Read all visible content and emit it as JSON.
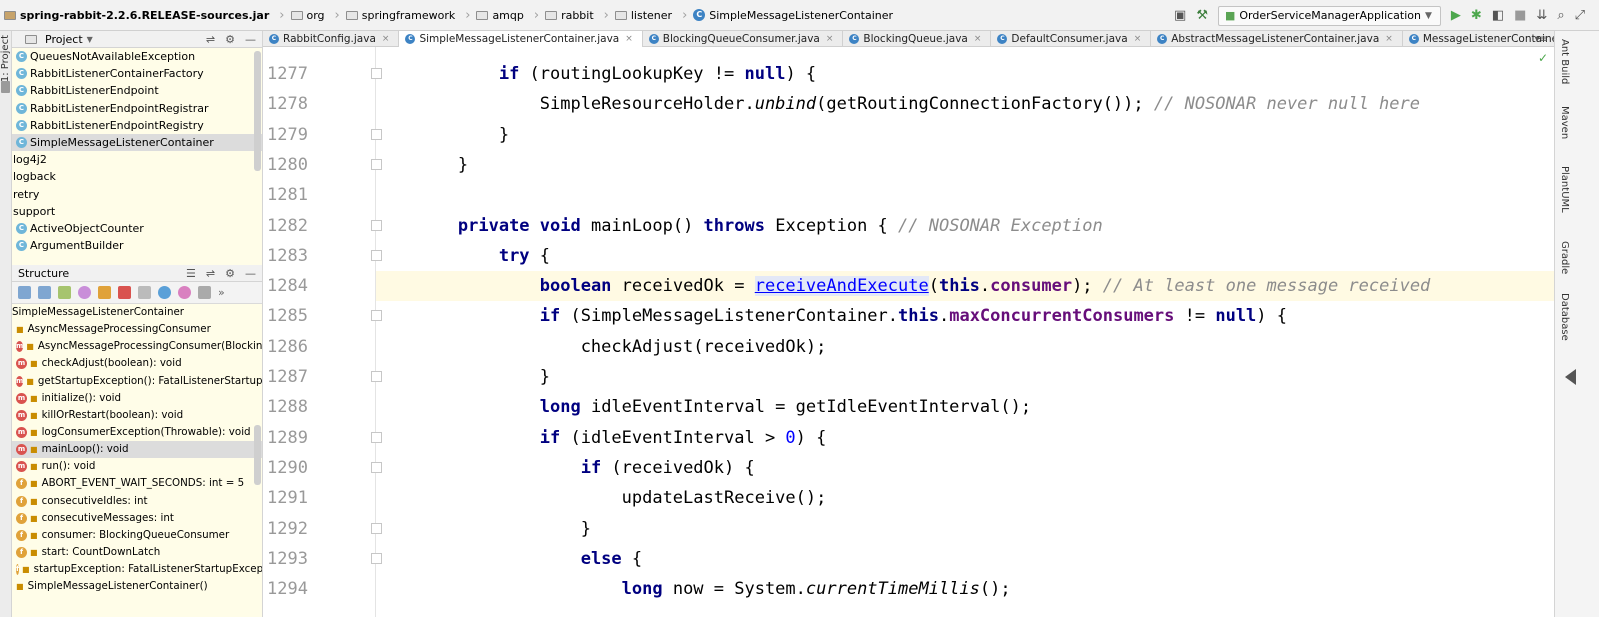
{
  "breadcrumbs": [
    {
      "label": "spring-rabbit-2.2.6.RELEASE-sources.jar",
      "kind": "jar"
    },
    {
      "label": "org",
      "kind": "folder"
    },
    {
      "label": "springframework",
      "kind": "folder"
    },
    {
      "label": "amqp",
      "kind": "folder"
    },
    {
      "label": "rabbit",
      "kind": "folder"
    },
    {
      "label": "listener",
      "kind": "folder"
    },
    {
      "label": "SimpleMessageListenerContainer",
      "kind": "class"
    }
  ],
  "run_config": {
    "label": "OrderServiceManagerApplication"
  },
  "left_strip": {
    "project_label": "1: Project"
  },
  "right_strip": [
    "Ant Build",
    "Maven",
    "PlantUML",
    "Gradle",
    "Database"
  ],
  "project_panel": {
    "title": "Project",
    "items": [
      {
        "label": "QueuesNotAvailableException",
        "kind": "class"
      },
      {
        "label": "RabbitListenerContainerFactory",
        "kind": "class"
      },
      {
        "label": "RabbitListenerEndpoint",
        "kind": "class"
      },
      {
        "label": "RabbitListenerEndpointRegistrar",
        "kind": "class"
      },
      {
        "label": "RabbitListenerEndpointRegistry",
        "kind": "class"
      },
      {
        "label": "SimpleMessageListenerContainer",
        "kind": "class",
        "selected": true
      },
      {
        "label": "log4j2",
        "kind": "package"
      },
      {
        "label": "logback",
        "kind": "package"
      },
      {
        "label": "retry",
        "kind": "package"
      },
      {
        "label": "support",
        "kind": "package"
      },
      {
        "label": "ActiveObjectCounter",
        "kind": "class"
      },
      {
        "label": "ArgumentBuilder",
        "kind": "class"
      }
    ]
  },
  "structure_panel": {
    "title": "Structure",
    "items": [
      {
        "label": "SimpleMessageListenerContainer",
        "icon": "none",
        "indent": 0
      },
      {
        "label": "AsyncMessageProcessingConsumer",
        "icon": "lock",
        "indent": 1
      },
      {
        "label": "AsyncMessageProcessingConsumer(BlockingQ",
        "icon": "m",
        "indent": 2
      },
      {
        "label": "checkAdjust(boolean): void",
        "icon": "m",
        "indent": 2
      },
      {
        "label": "getStartupException(): FatalListenerStartupExce",
        "icon": "m",
        "indent": 2
      },
      {
        "label": "initialize(): void",
        "icon": "m",
        "indent": 2
      },
      {
        "label": "killOrRestart(boolean): void",
        "icon": "m",
        "indent": 2
      },
      {
        "label": "logConsumerException(Throwable): void",
        "icon": "m",
        "indent": 2
      },
      {
        "label": "mainLoop(): void",
        "icon": "m",
        "indent": 2,
        "selected": true
      },
      {
        "label": "run(): void",
        "icon": "m",
        "indent": 2
      },
      {
        "label": "ABORT_EVENT_WAIT_SECONDS: int = 5",
        "icon": "f",
        "indent": 2
      },
      {
        "label": "consecutiveIdles: int",
        "icon": "f",
        "indent": 2
      },
      {
        "label": "consecutiveMessages: int",
        "icon": "f",
        "indent": 2
      },
      {
        "label": "consumer: BlockingQueueConsumer",
        "icon": "f",
        "indent": 2
      },
      {
        "label": "start: CountDownLatch",
        "icon": "f",
        "indent": 2
      },
      {
        "label": "startupException: FatalListenerStartupExceptio",
        "icon": "f",
        "indent": 2
      },
      {
        "label": "SimpleMessageListenerContainer()",
        "icon": "lock",
        "indent": 1
      }
    ]
  },
  "tabs": [
    {
      "label": "RabbitConfig.java",
      "active": false
    },
    {
      "label": "SimpleMessageListenerContainer.java",
      "active": true
    },
    {
      "label": "BlockingQueueConsumer.java",
      "active": false
    },
    {
      "label": "BlockingQueue.java",
      "active": false
    },
    {
      "label": "DefaultConsumer.java",
      "active": false
    },
    {
      "label": "AbstractMessageListenerContainer.java",
      "active": false
    },
    {
      "label": "MessageListenerContainer.java",
      "active": false
    }
  ],
  "editor": {
    "current_line": 1284,
    "lines": [
      {
        "n": "1277",
        "fold": true,
        "segs": [
          [
            "            ",
            ""
          ],
          [
            "if",
            "kw"
          ],
          [
            " (routingLookupKey != ",
            ""
          ],
          [
            "null",
            "kw"
          ],
          [
            ") {",
            ""
          ]
        ]
      },
      {
        "n": "1278",
        "fold": false,
        "segs": [
          [
            "                SimpleResourceHolder.",
            ""
          ],
          [
            "unbind",
            "it"
          ],
          [
            "(getRoutingConnectionFactory()); ",
            ""
          ],
          [
            "// NOSONAR never null here",
            "cm"
          ]
        ]
      },
      {
        "n": "1279",
        "fold": true,
        "segs": [
          [
            "            }",
            ""
          ]
        ]
      },
      {
        "n": "1280",
        "fold": true,
        "segs": [
          [
            "        }",
            ""
          ]
        ]
      },
      {
        "n": "1281",
        "fold": false,
        "segs": [
          [
            "",
            ""
          ]
        ]
      },
      {
        "n": "1282",
        "fold": true,
        "segs": [
          [
            "        ",
            ""
          ],
          [
            "private void",
            "kw"
          ],
          [
            " mainLoop() ",
            ""
          ],
          [
            "throws",
            "kw"
          ],
          [
            " Exception { ",
            ""
          ],
          [
            "// NOSONAR Exception",
            "cm"
          ]
        ]
      },
      {
        "n": "1283",
        "fold": true,
        "segs": [
          [
            "            ",
            ""
          ],
          [
            "try",
            "kw"
          ],
          [
            " {",
            ""
          ]
        ]
      },
      {
        "n": "1284",
        "fold": false,
        "segs": [
          [
            "                ",
            ""
          ],
          [
            "boolean",
            "kw"
          ],
          [
            " receivedOk = ",
            ""
          ],
          [
            "receiveAndExecute",
            "link"
          ],
          [
            "(",
            ""
          ],
          [
            "this",
            "kw"
          ],
          [
            ".",
            ""
          ],
          [
            "consumer",
            "fld"
          ],
          [
            "); ",
            ""
          ],
          [
            "// At least one message received",
            "cm"
          ]
        ]
      },
      {
        "n": "1285",
        "fold": true,
        "segs": [
          [
            "                ",
            ""
          ],
          [
            "if",
            "kw"
          ],
          [
            " (SimpleMessageListenerContainer.",
            ""
          ],
          [
            "this",
            "kw"
          ],
          [
            ".",
            ""
          ],
          [
            "maxConcurrentConsumers",
            "fld"
          ],
          [
            " != ",
            ""
          ],
          [
            "null",
            "kw"
          ],
          [
            ") {",
            ""
          ]
        ]
      },
      {
        "n": "1286",
        "fold": false,
        "segs": [
          [
            "                    checkAdjust(receivedOk);",
            ""
          ]
        ]
      },
      {
        "n": "1287",
        "fold": true,
        "segs": [
          [
            "                }",
            ""
          ]
        ]
      },
      {
        "n": "1288",
        "fold": false,
        "segs": [
          [
            "                ",
            ""
          ],
          [
            "long",
            "kw"
          ],
          [
            " idleEventInterval = getIdleEventInterval();",
            ""
          ]
        ]
      },
      {
        "n": "1289",
        "fold": true,
        "segs": [
          [
            "                ",
            ""
          ],
          [
            "if",
            "kw"
          ],
          [
            " (idleEventInterval > ",
            ""
          ],
          [
            "0",
            "num"
          ],
          [
            ") {",
            ""
          ]
        ]
      },
      {
        "n": "1290",
        "fold": true,
        "segs": [
          [
            "                    ",
            ""
          ],
          [
            "if",
            "kw"
          ],
          [
            " (receivedOk) {",
            ""
          ]
        ]
      },
      {
        "n": "1291",
        "fold": false,
        "segs": [
          [
            "                        updateLastReceive();",
            ""
          ]
        ]
      },
      {
        "n": "1292",
        "fold": true,
        "segs": [
          [
            "                    }",
            ""
          ]
        ]
      },
      {
        "n": "1293",
        "fold": true,
        "segs": [
          [
            "                    ",
            ""
          ],
          [
            "else",
            "kw"
          ],
          [
            " {",
            ""
          ]
        ]
      },
      {
        "n": "1294",
        "fold": false,
        "segs": [
          [
            "                        ",
            ""
          ],
          [
            "long",
            "kw"
          ],
          [
            " now = System.",
            ""
          ],
          [
            "currentTimeMillis",
            "it"
          ],
          [
            "();",
            ""
          ]
        ]
      }
    ]
  }
}
